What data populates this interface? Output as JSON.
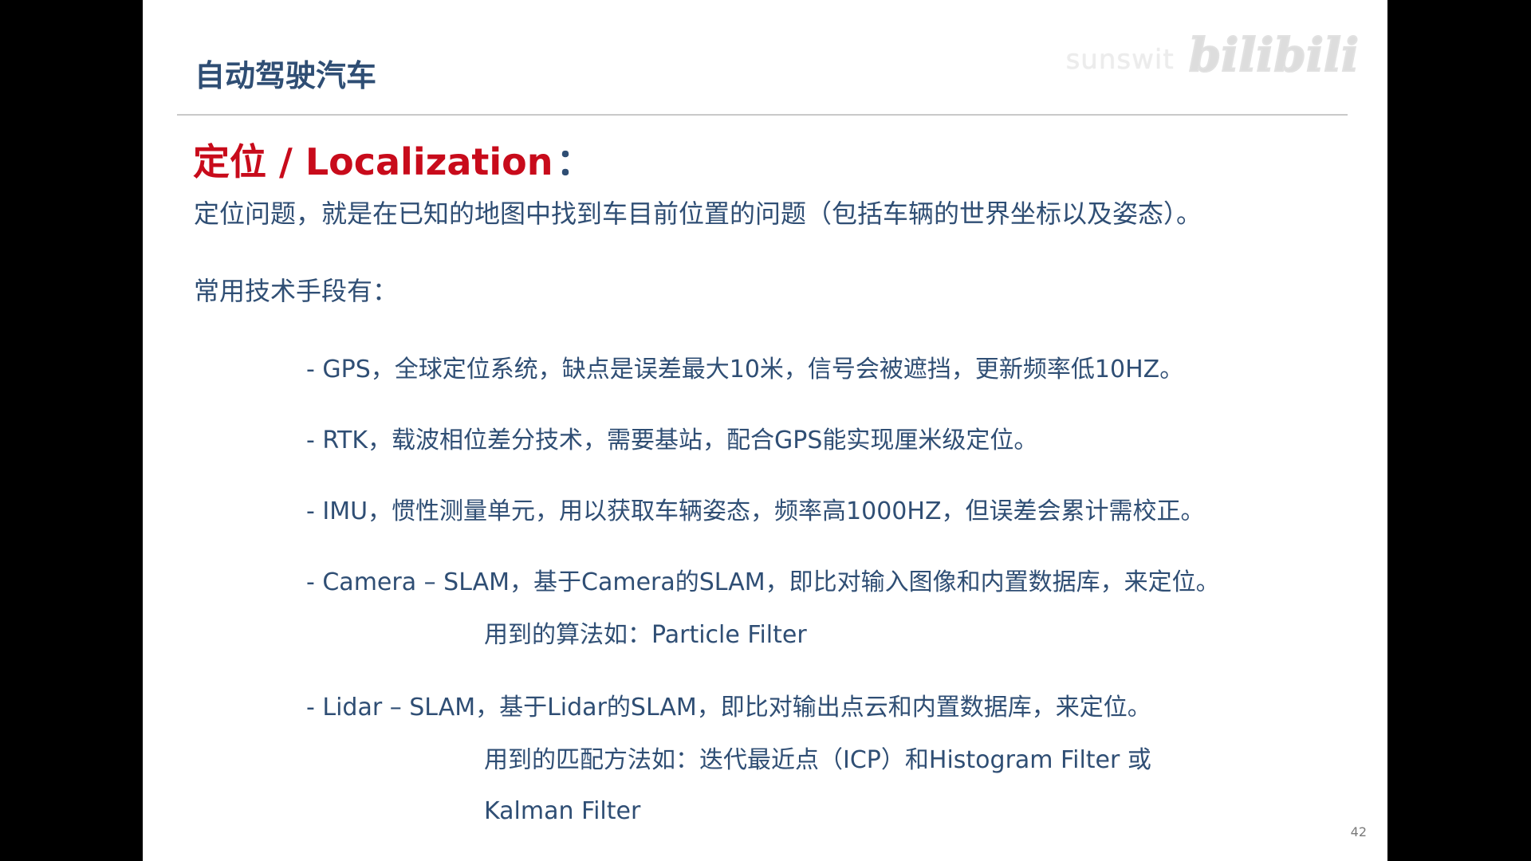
{
  "watermark": {
    "user": "sunswit",
    "logo": "bilibili"
  },
  "header": {
    "title": "自动驾驶汽车"
  },
  "section": {
    "heading": "定位 / Localization",
    "colon": "：",
    "description": "定位问题，就是在已知的地图中找到车目前位置的问题（包括车辆的世界坐标以及姿态）。"
  },
  "methods": {
    "title": "常用技术手段有：",
    "items": [
      "- GPS，全球定位系统，缺点是误差最大10米，信号会被遮挡，更新频率低10HZ。",
      "- RTK，载波相位差分技术，需要基站，配合GPS能实现厘米级定位。",
      "- IMU，惯性测量单元，用以获取车辆姿态，频率高1000HZ，但误差会累计需校正。",
      "- Camera – SLAM，基于Camera的SLAM，即比对输入图像和内置数据库，来定位。",
      "- Lidar – SLAM，基于Lidar的SLAM，即比对输出点云和内置数据库，来定位。"
    ],
    "camera_algorithms": "用到的算法如：Particle Filter",
    "lidar_algorithms_line1": "用到的匹配方法如：迭代最近点（ICP）和Histogram Filter 或",
    "lidar_algorithms_line2": "Kalman Filter"
  },
  "page_number": "42"
}
